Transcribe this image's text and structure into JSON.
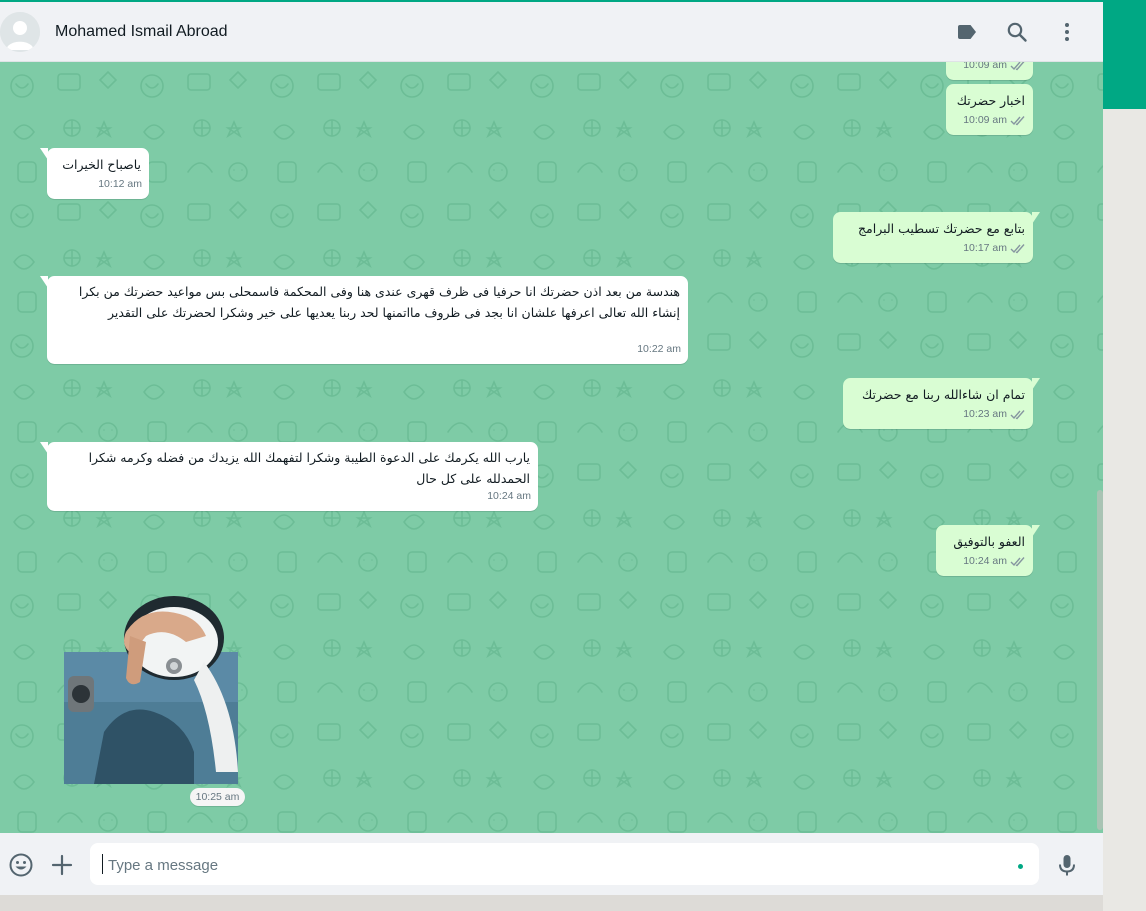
{
  "header": {
    "contact_name": "Mohamed Ismail Abroad",
    "icons": [
      "label-icon",
      "search-icon",
      "menu-icon"
    ]
  },
  "messages": [
    {
      "direction": "out",
      "text": "",
      "time": "10:09 am",
      "status": "read"
    },
    {
      "direction": "out",
      "text": "اخبار حضرتك",
      "time": "10:09 am",
      "status": "read"
    },
    {
      "direction": "in",
      "text": "ياصباح الخيرات",
      "time": "10:12 am"
    },
    {
      "direction": "out",
      "text": "بتابع مع حضرتك تسطيب البرامج",
      "time": "10:17 am",
      "status": "read"
    },
    {
      "direction": "in",
      "text": "هندسة من بعد اذن حضرتك انا حرفيا فى ظرف قهرى عندى هنا وفى المحكمة فاسمحلى بس مواعيد حضرتك من بكرا إنشاء الله تعالى اعرفها علشان انا بجد فى ظروف مااتمنها لحد ربنا يعديها على خير وشكرا لحضرتك على التقدير",
      "time": "10:22 am"
    },
    {
      "direction": "out",
      "text": "تمام ان شاءالله ربنا مع حضرتك",
      "time": "10:23 am",
      "status": "read"
    },
    {
      "direction": "in",
      "text": "يارب الله يكرمك على الدعوة الطيبة وشكرا لتفهمك الله يزيدك من فضله وكرمه شكرا الحمدلله على كل حال",
      "time": "10:24 am"
    },
    {
      "direction": "out",
      "text": "العفو بالتوفيق",
      "time": "10:24 am",
      "status": "read"
    },
    {
      "direction": "in",
      "type": "sticker",
      "time": "10:25 am"
    }
  ],
  "footer": {
    "placeholder": "Type a message",
    "value": "",
    "icons": [
      "emoji-icon",
      "plus-icon",
      "microphone-icon"
    ]
  },
  "colors": {
    "accent": "#00a884",
    "chat_background": "#7ecba6",
    "incoming_bubble": "#ffffff",
    "outgoing_bubble": "#d9fdd3",
    "header_background": "#f0f2f5"
  }
}
